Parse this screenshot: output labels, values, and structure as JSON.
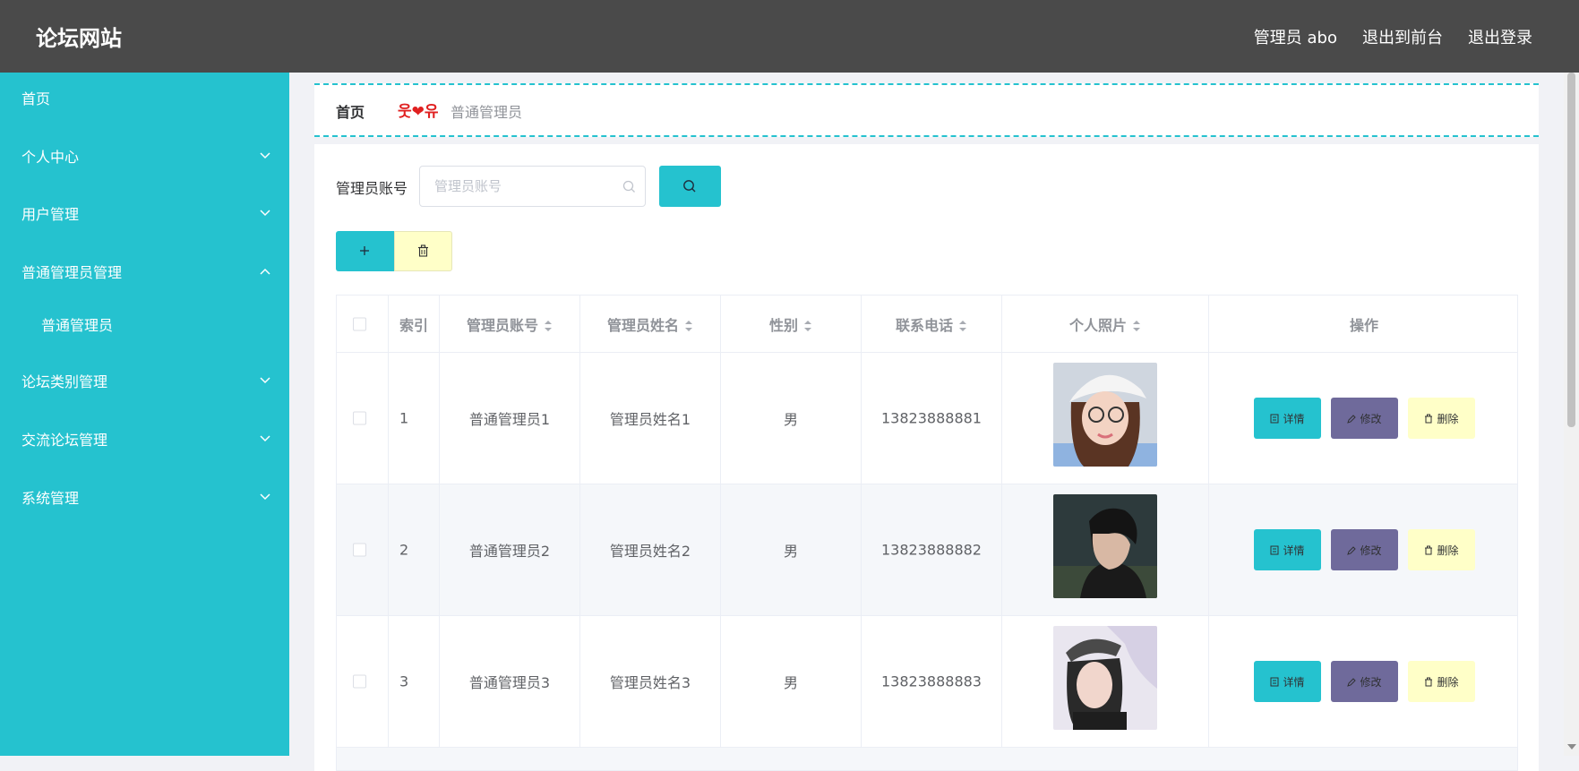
{
  "header": {
    "title": "论坛网站",
    "user_label": "管理员 abo",
    "front_link": "退出到前台",
    "logout_link": "退出登录"
  },
  "sidebar": {
    "items": [
      {
        "label": "首页",
        "has_chevron": false
      },
      {
        "label": "个人中心",
        "has_chevron": true,
        "expanded": false
      },
      {
        "label": "用户管理",
        "has_chevron": true,
        "expanded": false
      },
      {
        "label": "普通管理员管理",
        "has_chevron": true,
        "expanded": true
      },
      {
        "label": "普通管理员",
        "sub": true
      },
      {
        "label": "论坛类别管理",
        "has_chevron": true,
        "expanded": false
      },
      {
        "label": "交流论坛管理",
        "has_chevron": true,
        "expanded": false
      },
      {
        "label": "系统管理",
        "has_chevron": true,
        "expanded": false
      }
    ]
  },
  "breadcrumb": {
    "home": "首页",
    "separator": "웃❤유",
    "current": "普通管理员"
  },
  "search": {
    "label": "管理员账号",
    "placeholder": "管理员账号",
    "value": ""
  },
  "table": {
    "columns": [
      "索引",
      "管理员账号",
      "管理员姓名",
      "性别",
      "联系电话",
      "个人照片",
      "操作"
    ],
    "rows": [
      {
        "index": "1",
        "account": "普通管理员1",
        "name": "管理员姓名1",
        "gender": "男",
        "phone": "13823888881",
        "photo": "photo-1"
      },
      {
        "index": "2",
        "account": "普通管理员2",
        "name": "管理员姓名2",
        "gender": "男",
        "phone": "13823888882",
        "photo": "photo-2"
      },
      {
        "index": "3",
        "account": "普通管理员3",
        "name": "管理员姓名3",
        "gender": "男",
        "phone": "13823888883",
        "photo": "photo-3"
      }
    ],
    "actions": {
      "detail": "详情",
      "edit": "修改",
      "delete": "删除"
    }
  },
  "colors": {
    "accent": "#25c2cf",
    "header": "#4a4a4a",
    "edit": "#6f6a9b",
    "delete": "#ffffc8",
    "breadcrumb_separator": "#e02020"
  }
}
